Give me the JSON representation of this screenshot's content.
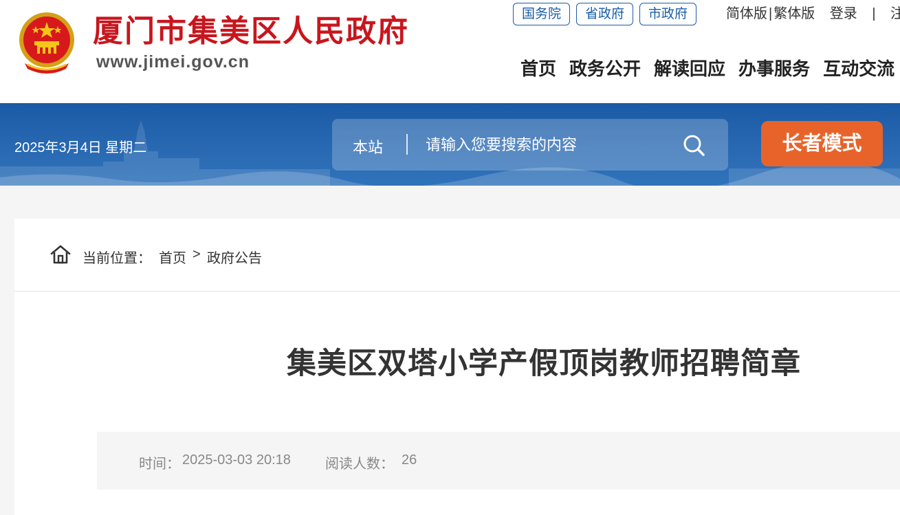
{
  "header": {
    "site_title": "厦门市集美区人民政府",
    "site_url": "www.jimei.gov.cn",
    "gov_links": [
      "国务院",
      "省政府",
      "市政府"
    ],
    "lang_simplified": "简体版",
    "lang_separator": "|",
    "lang_traditional": "繁体版",
    "login": "登录",
    "separator": "|",
    "cut_off_item": "注",
    "nav": [
      "首页",
      "政务公开",
      "解读回应",
      "办事服务",
      "互动交流"
    ]
  },
  "banner": {
    "date": "2025年3月4日 星期二",
    "search_scope": "本站",
    "search_placeholder": "请输入您要搜索的内容",
    "elder_mode": "长者模式"
  },
  "breadcrumb": {
    "label": "当前位置：",
    "home": "首页",
    "separator": ">",
    "current": "政府公告"
  },
  "article": {
    "title": "集美区双塔小学产假顶岗教师招聘简章",
    "time_label": "时间：",
    "time_value": "2025-03-03 20:18",
    "reads_label": "阅读人数：",
    "reads_value": "26"
  },
  "colors": {
    "brand_red": "#c8161d",
    "link_blue": "#1a5ca8",
    "banner_blue": "#1b5aa5",
    "elder_orange": "#e8632a"
  },
  "icons": [
    "national-emblem-icon",
    "search-icon",
    "home-icon"
  ]
}
